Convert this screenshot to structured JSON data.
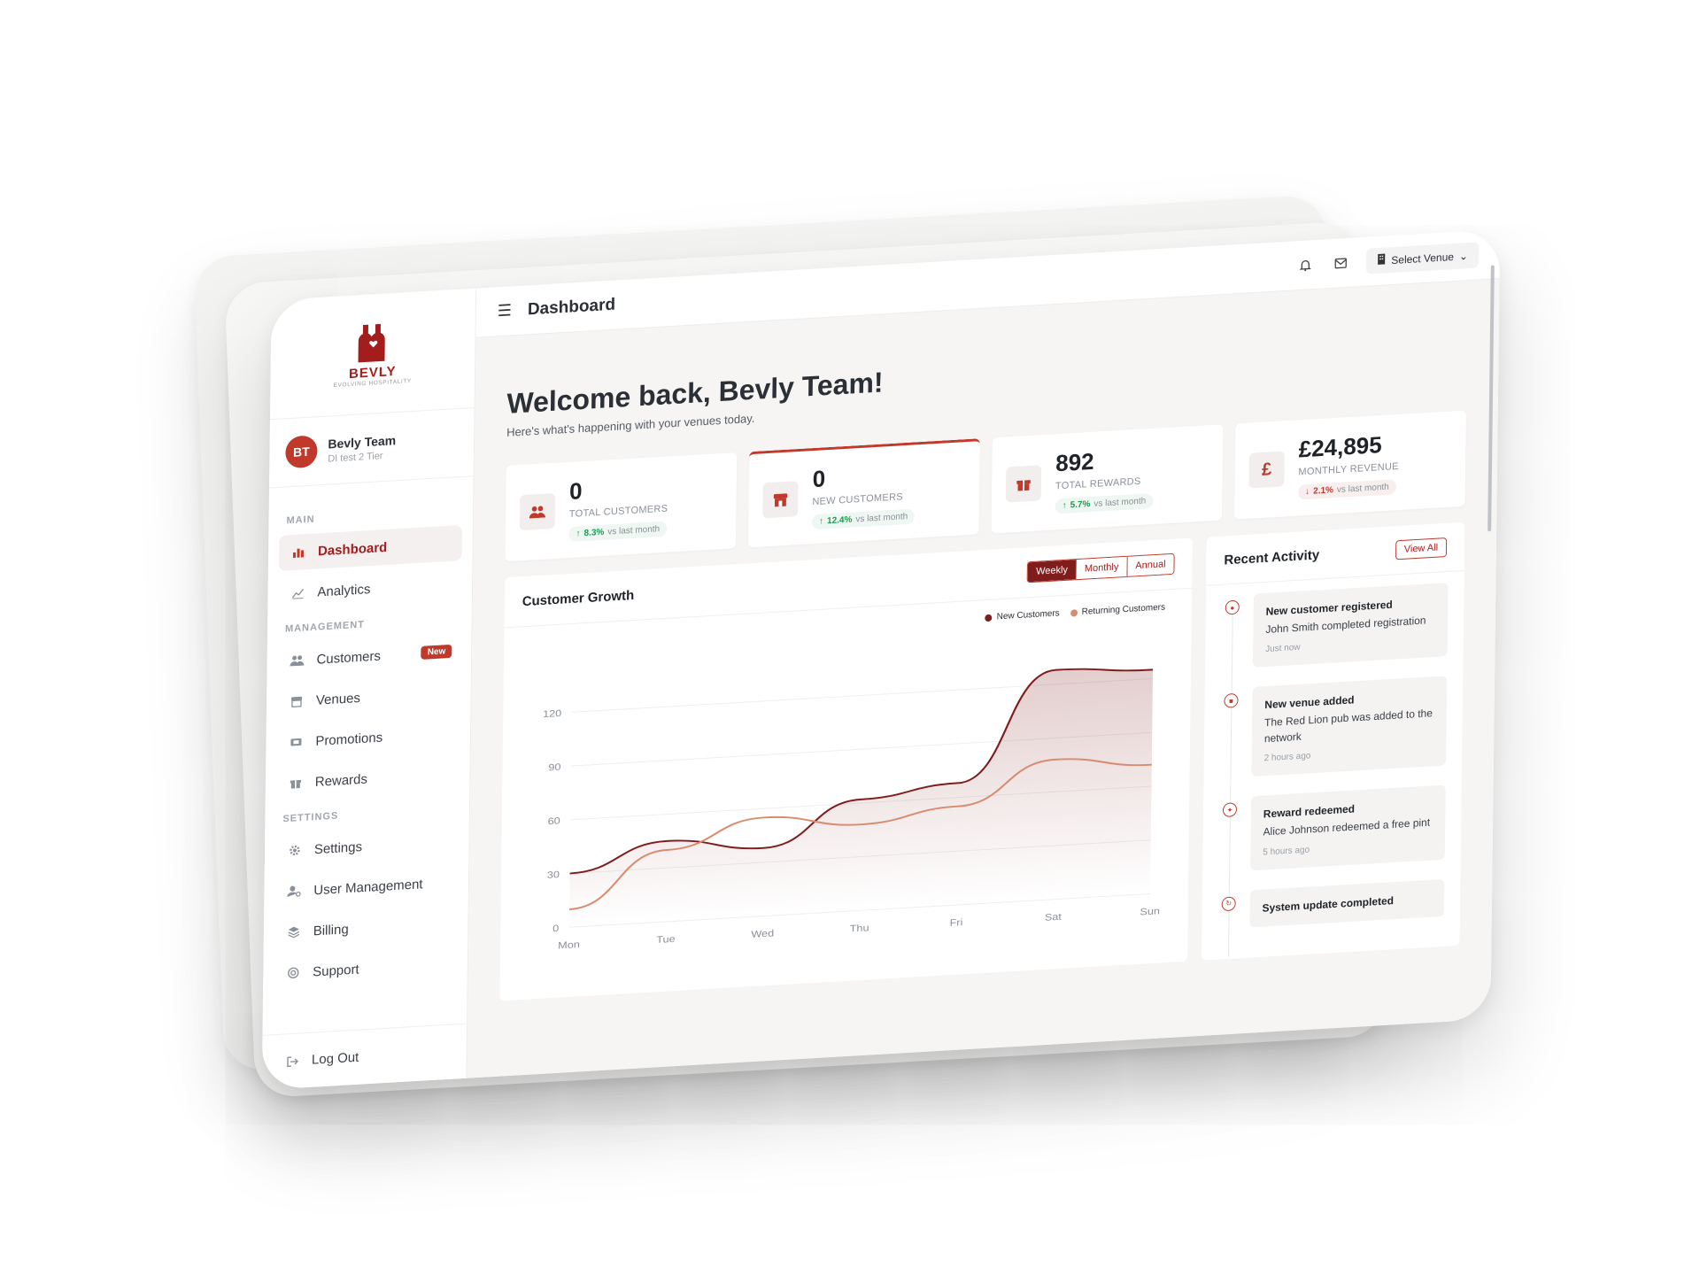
{
  "brand": {
    "name": "BEVLY",
    "tagline": "EVOLVING HOSPITALITY",
    "accent": "#c0392b",
    "accent_dark": "#7f1d1d"
  },
  "header": {
    "title": "Dashboard",
    "venue_select": "Select Venue"
  },
  "user": {
    "initials": "BT",
    "name": "Bevly Team",
    "subtitle": "DI test 2 Tier"
  },
  "sidebar": {
    "sections": {
      "main": "MAIN",
      "management": "MANAGEMENT",
      "settings": "SETTINGS"
    },
    "main_items": [
      {
        "label": "Dashboard",
        "icon": "bar-chart-icon"
      },
      {
        "label": "Analytics",
        "icon": "line-chart-icon"
      }
    ],
    "management_items": [
      {
        "label": "Customers",
        "icon": "users-icon",
        "badge": "New"
      },
      {
        "label": "Venues",
        "icon": "store-icon"
      },
      {
        "label": "Promotions",
        "icon": "ticket-icon"
      },
      {
        "label": "Rewards",
        "icon": "gift-icon"
      }
    ],
    "settings_items": [
      {
        "label": "Settings",
        "icon": "gear-icon"
      },
      {
        "label": "User Management",
        "icon": "user-cog-icon"
      },
      {
        "label": "Billing",
        "icon": "layers-icon"
      },
      {
        "label": "Support",
        "icon": "lifebuoy-icon"
      }
    ],
    "logout": "Log Out"
  },
  "welcome": {
    "title": "Welcome back, Bevly Team!",
    "subtitle": "Here's what's happening with your venues today."
  },
  "stats": [
    {
      "value": "0",
      "label": "TOTAL CUSTOMERS",
      "trend": "8.3%",
      "direction": "up",
      "note": "vs last month",
      "icon": "users-icon"
    },
    {
      "value": "0",
      "label": "NEW CUSTOMERS",
      "trend": "12.4%",
      "direction": "up",
      "note": "vs last month",
      "icon": "store-icon"
    },
    {
      "value": "892",
      "label": "TOTAL REWARDS",
      "trend": "5.7%",
      "direction": "up",
      "note": "vs last month",
      "icon": "gift-icon"
    },
    {
      "value": "£24,895",
      "label": "MONTHLY REVENUE",
      "trend": "2.1%",
      "direction": "down",
      "note": "vs last month",
      "icon": "pound-icon"
    }
  ],
  "growth": {
    "title": "Customer Growth",
    "periods": [
      "Weekly",
      "Monthly",
      "Annual"
    ],
    "active_period": "Weekly"
  },
  "chart_data": {
    "type": "area",
    "categories": [
      "Mon",
      "Tue",
      "Wed",
      "Thu",
      "Fri",
      "Sat",
      "Sun"
    ],
    "series": [
      {
        "name": "New Customers",
        "values": [
          30,
          45,
          38,
          62,
          68,
          128,
          125
        ],
        "color": "#7f1d1d"
      },
      {
        "name": "Returning Customers",
        "values": [
          10,
          40,
          55,
          48,
          55,
          78,
          72
        ],
        "color": "#d98b6f"
      }
    ],
    "yticks": [
      0,
      30,
      60,
      90,
      120
    ],
    "ylim": [
      0,
      140
    ],
    "grid": true,
    "legend": "top-right"
  },
  "activity": {
    "title": "Recent Activity",
    "view_all": "View All",
    "items": [
      {
        "title": "New customer registered",
        "desc": "John Smith completed registration",
        "time": "Just now",
        "icon": "user-plus-icon"
      },
      {
        "title": "New venue added",
        "desc": "The Red Lion pub was added to the network",
        "time": "2 hours ago",
        "icon": "store-icon"
      },
      {
        "title": "Reward redeemed",
        "desc": "Alice Johnson redeemed a free pint",
        "time": "5 hours ago",
        "icon": "gift-icon"
      },
      {
        "title": "System update completed",
        "desc": "",
        "time": "",
        "icon": "refresh-icon"
      }
    ]
  }
}
